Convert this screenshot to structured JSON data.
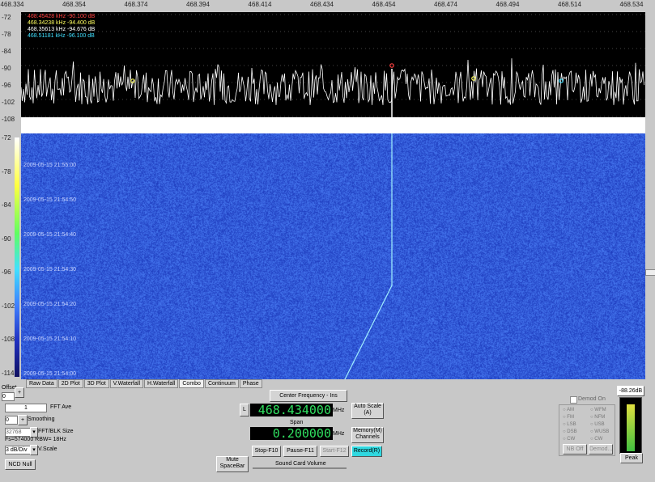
{
  "freq_axis": [
    "468.334",
    "468.354",
    "468.374",
    "468.394",
    "468.414",
    "468.434",
    "468.454",
    "468.474",
    "468.494",
    "468.514",
    "468.534"
  ],
  "spectrum_y": [
    "-72",
    "-78",
    "-84",
    "-90",
    "-96",
    "-102",
    "-108"
  ],
  "waterfall_y": [
    "-72",
    "-78",
    "-84",
    "-90",
    "-96",
    "-102",
    "-108",
    "-114"
  ],
  "markers": [
    {
      "text": "468.45428 kHz -90.100 dB",
      "color": "#ff4040"
    },
    {
      "text": "468.34238 kHz -94.400 dB",
      "color": "#ffff60"
    },
    {
      "text": "468.35613 kHz -94.676 dB",
      "color": "#ffffff"
    },
    {
      "text": "468.51181 kHz -96.100 dB",
      "color": "#40e0ff"
    }
  ],
  "timestamps": [
    "2009-05-15 21:55:00",
    "2009-05-15 21:54:50",
    "2009-05-15 21:54:40",
    "2009-05-15 21:54:30",
    "2009-05-15 21:54:20",
    "2009-05-15 21:54:10",
    "2009-05-15 21:54:00"
  ],
  "tabs": [
    "Raw Data",
    "2D Plot",
    "3D Plot",
    "V.Waterfall",
    "H.Waterfall",
    "Combo",
    "Continuum",
    "Phase"
  ],
  "active_tab": "Combo",
  "controls": {
    "offset_label": "Offset",
    "offset_value": "0",
    "fft_ave_value": "1",
    "fft_ave_label": "FFT Ave",
    "smoothing_value": "0",
    "smoothing_label": "Smoothing",
    "fft_size_value": "32768",
    "fft_size_label": "FFT/BLK Size",
    "fs_text": "Fs=574000 RBW= 18Hz",
    "vscale_value": "3 dB/Div",
    "vscale_label": "V.Scale",
    "ncd_null": "NCD Null",
    "center_freq_label": "Center Frequency - Ins",
    "l_button": "L",
    "center_freq_value": "468.434000",
    "mhz1": "MHz",
    "auto_scale": "Auto Scale (A)",
    "span_label": "Span",
    "span_value": "0.200000",
    "mhz2": "MHz",
    "memory_channels": "Memory(M) Channels",
    "stop": "Stop-F10",
    "pause": "Pause-F11",
    "start": "Start-F12",
    "record": "Record(R)",
    "mute": "Mute SpaceBar",
    "sound_card_volume": "Sound Card Volume",
    "demod_on": "Demod On",
    "demod_modes": [
      "AM",
      "WFM",
      "FM",
      "NFM",
      "LSB",
      "USB",
      "DSB",
      "WUSB",
      "CW",
      "CW"
    ],
    "nb_label": "NB Off",
    "demod_settings": "Demod...",
    "db_readout": "-88.26dB",
    "peak": "Peak"
  }
}
